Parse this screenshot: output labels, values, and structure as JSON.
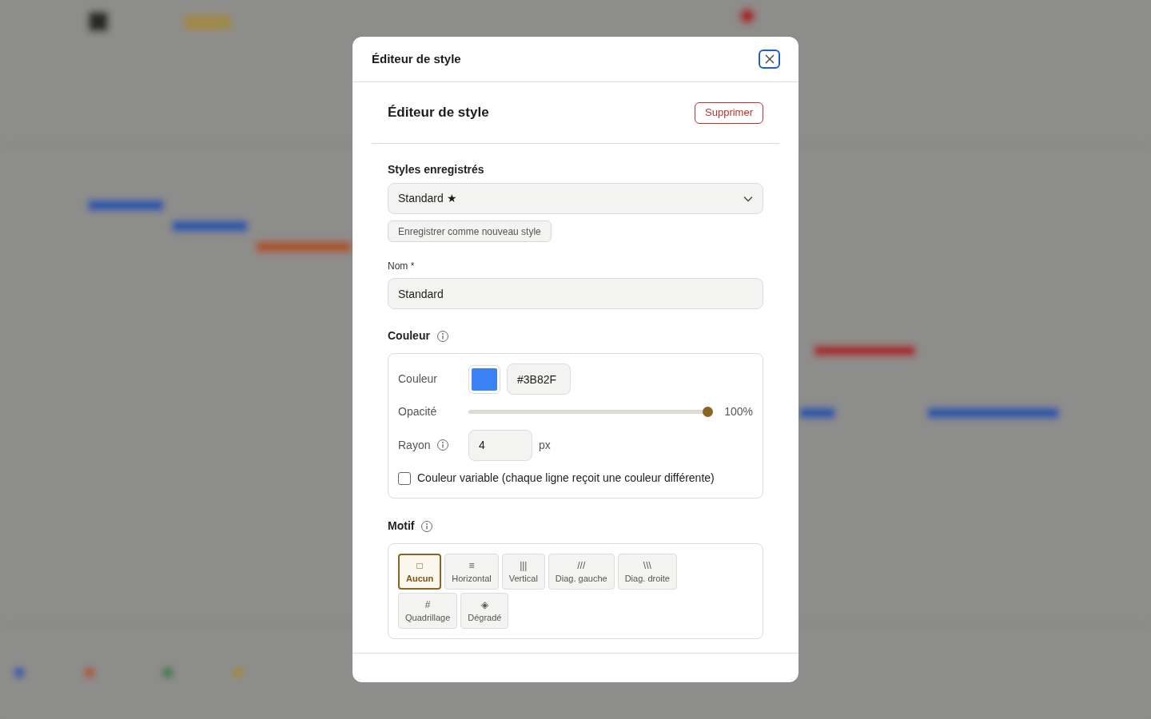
{
  "dialog": {
    "title": "Éditeur de style"
  },
  "editor": {
    "heading": "Éditeur de style",
    "delete_button": "Supprimer",
    "saved_styles": {
      "label": "Styles enregistrés",
      "value": "Standard ★",
      "save_button": "Enregistrer comme nouveau style"
    },
    "name": {
      "label": "Nom *",
      "value": "Standard"
    },
    "color_section": {
      "heading": "Couleur",
      "color": {
        "label": "Couleur",
        "color": "#3b82f6",
        "hex": "#3B82F"
      },
      "opacity": {
        "label": "Opacité",
        "level": 1,
        "reading": "100%"
      },
      "radius": {
        "label": "Rayon",
        "value": "4",
        "unit": "px"
      },
      "variable": {
        "label": "Couleur variable (chaque ligne reçoit une couleur différente)",
        "checked": false
      }
    },
    "pattern_section": {
      "heading": "Motif",
      "options": [
        {
          "icon": "□",
          "label": "Aucun",
          "selected": true
        },
        {
          "icon": "≡",
          "label": "Horizontal",
          "selected": false
        },
        {
          "icon": "|||",
          "label": "Vertical",
          "selected": false
        },
        {
          "icon": "///",
          "label": "Diag. gauche",
          "selected": false
        },
        {
          "icon": "\\\\\\",
          "label": "Diag. droite",
          "selected": false
        },
        {
          "icon": "#",
          "label": "Quadrillage",
          "selected": false
        },
        {
          "icon": "◈",
          "label": "Dégradé",
          "selected": false
        }
      ]
    }
  }
}
